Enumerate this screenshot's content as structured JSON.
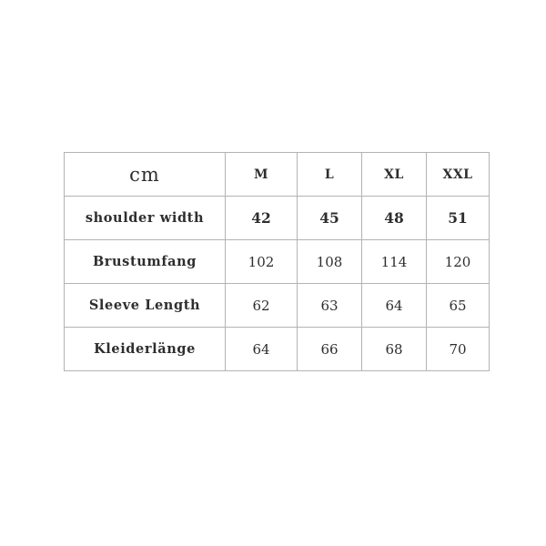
{
  "document": {
    "kind": "size-chart",
    "background_color": "#ffffff",
    "border_color": "#b3b3b3",
    "text_color": "#2e2e2e"
  },
  "table": {
    "unit_label": "cm",
    "size_headers": [
      "M",
      "L",
      "XL",
      "XXL"
    ],
    "rows": [
      {
        "label": "shoulder width",
        "emphasis": true,
        "values": [
          "42",
          "45",
          "48",
          "51"
        ]
      },
      {
        "label": "Brustumfang",
        "emphasis": false,
        "values": [
          "102",
          "108",
          "114",
          "120"
        ]
      },
      {
        "label": "Sleeve Length",
        "emphasis": false,
        "values": [
          "62",
          "63",
          "64",
          "65"
        ]
      },
      {
        "label": "Kleiderlänge",
        "emphasis": false,
        "values": [
          "64",
          "66",
          "68",
          "70"
        ]
      }
    ]
  }
}
